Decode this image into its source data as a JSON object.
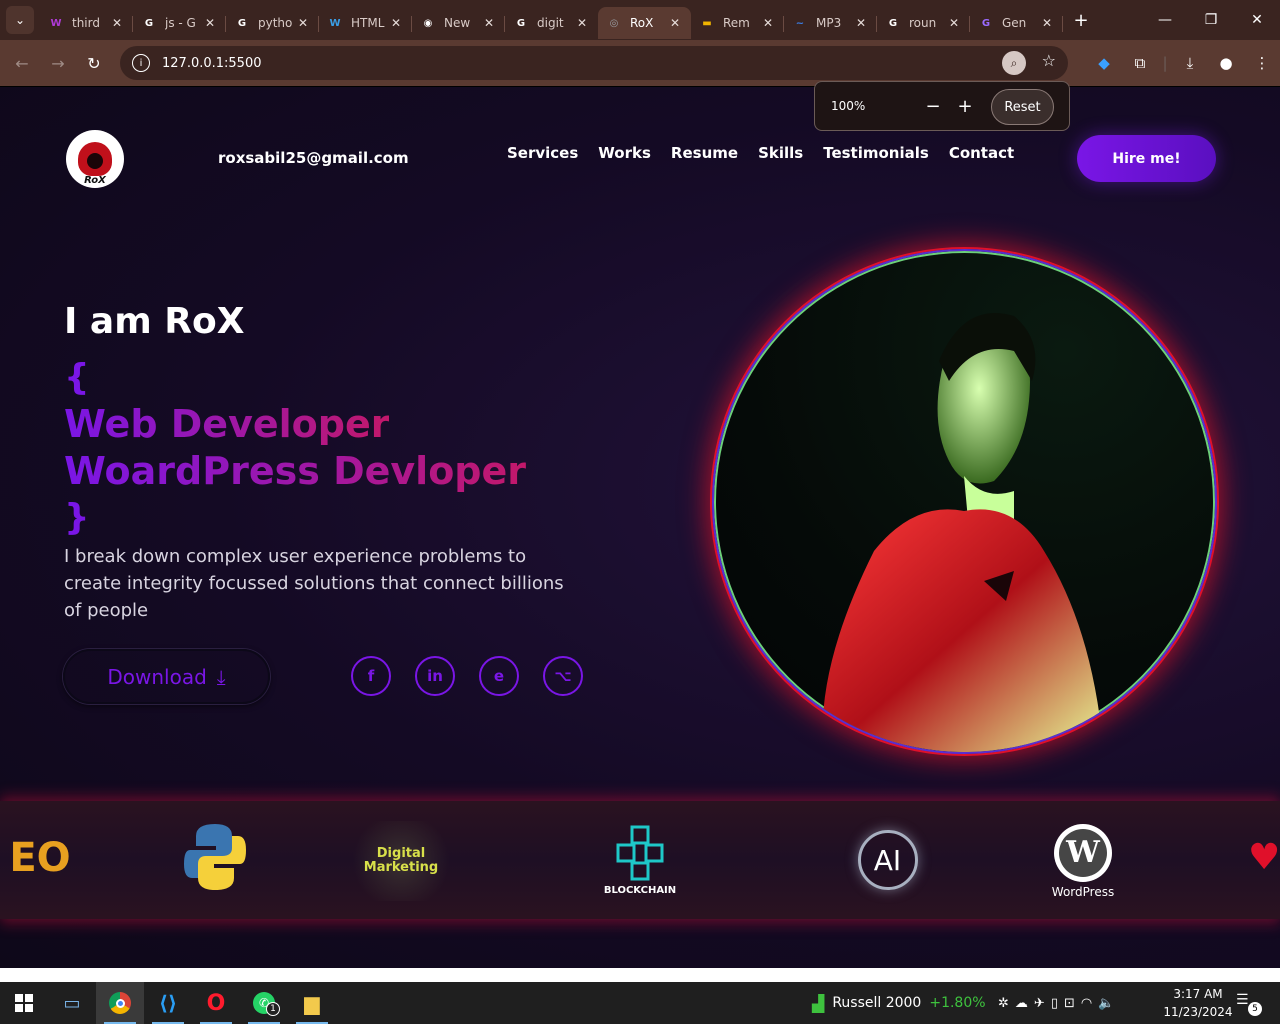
{
  "browser": {
    "tabs": [
      {
        "label": "third",
        "favicon": "W",
        "favcolor": "#b03ad8",
        "active": false
      },
      {
        "label": "js - G",
        "favicon": "G",
        "favcolor": "#ffffff",
        "active": false
      },
      {
        "label": "pytho",
        "favicon": "G",
        "favcolor": "#ffffff",
        "active": false
      },
      {
        "label": "HTML",
        "favicon": "W",
        "favcolor": "#3a9ee6",
        "active": false
      },
      {
        "label": "New",
        "favicon": "◉",
        "favcolor": "#ffffff",
        "active": false
      },
      {
        "label": "digit",
        "favicon": "G",
        "favcolor": "#ffffff",
        "active": false
      },
      {
        "label": "RoX",
        "favicon": "◎",
        "favcolor": "#9aa0a6",
        "active": true
      },
      {
        "label": "Rem",
        "favicon": "▬",
        "favcolor": "#f0b400",
        "active": false
      },
      {
        "label": "MP3",
        "favicon": "~",
        "favcolor": "#3a7ee6",
        "active": false
      },
      {
        "label": "roun",
        "favicon": "G",
        "favcolor": "#ffffff",
        "active": false
      },
      {
        "label": "Gen",
        "favicon": "G",
        "favcolor": "#9b6bff",
        "active": false
      }
    ],
    "url": "127.0.0.1:5500",
    "zoom": {
      "value": "100%",
      "reset_label": "Reset"
    }
  },
  "site": {
    "logo_text": "RoX",
    "email": "roxsabil25@gmail.com",
    "nav": [
      "Services",
      "Works",
      "Resume",
      "Skills",
      "Testimonials",
      "Contact"
    ],
    "hire_label": "Hire me!",
    "hero": {
      "title": "I am RoX",
      "brace_open": "{",
      "role1": "Web Developer",
      "role2": "WoardPress Devloper",
      "brace_close": "}",
      "description": "I break down complex user experience problems to create integrity focussed solutions that connect billions of people",
      "download_label": "Download"
    },
    "socials": [
      "facebook-icon",
      "linkedin-icon",
      "edge-icon",
      "github-icon"
    ],
    "skills": [
      {
        "name": "seo-logo",
        "label": "EO"
      },
      {
        "name": "python-logo",
        "label": ""
      },
      {
        "name": "digital-marketing-logo",
        "label": "Digital Marketing"
      },
      {
        "name": "blockchain-logo",
        "label": "BLOCKCHAIN"
      },
      {
        "name": "ai-logo",
        "label": "AI"
      },
      {
        "name": "wordpress-logo",
        "label": "WordPress"
      }
    ]
  },
  "taskbar": {
    "stock_name": "Russell 2000",
    "stock_change": "+1.80%",
    "time": "3:17 AM",
    "date": "11/23/2024",
    "notifications": "5",
    "whatsapp_badge": "1"
  },
  "colors": {
    "accent": "#7a16e6",
    "accent2": "#c2186a",
    "stock_up": "#3ec23e"
  }
}
